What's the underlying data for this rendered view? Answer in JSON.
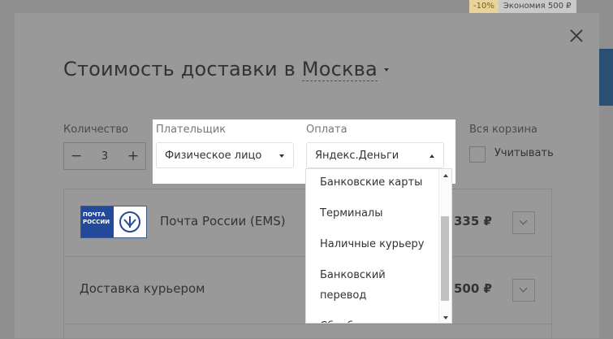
{
  "background": {
    "badge_discount": "-10%",
    "badge_savings": "Экономия 500 ₽"
  },
  "modal": {
    "title_prefix": "Стоимость доставки в",
    "city": "Москва",
    "quantity_label": "Количество",
    "quantity_value": "3",
    "minus": "−",
    "plus": "+",
    "payer_label": "Плательщик",
    "payer_value": "Физическое лицо",
    "payment_label": "Оплата",
    "payment_value": "Яндекс.Деньги",
    "cart_label": "Вся корзина",
    "cart_checkbox_label": "Учитывать",
    "rows": [
      {
        "name": "Почта России (EMS)",
        "price": "335 ₽",
        "logo_text": "ПОЧТА РОССИИ"
      },
      {
        "name": "Доставка курьером",
        "price": "500 ₽"
      }
    ],
    "dropdown": {
      "options": [
        "Банковские карты",
        "Терминалы",
        "Наличные курьеру",
        "Банковский перевод",
        "Сбербанк"
      ]
    }
  },
  "colors": {
    "overlay": "#8f8f8f",
    "modal_dimmed": "#999999",
    "accent_blue": "#234a9a"
  }
}
